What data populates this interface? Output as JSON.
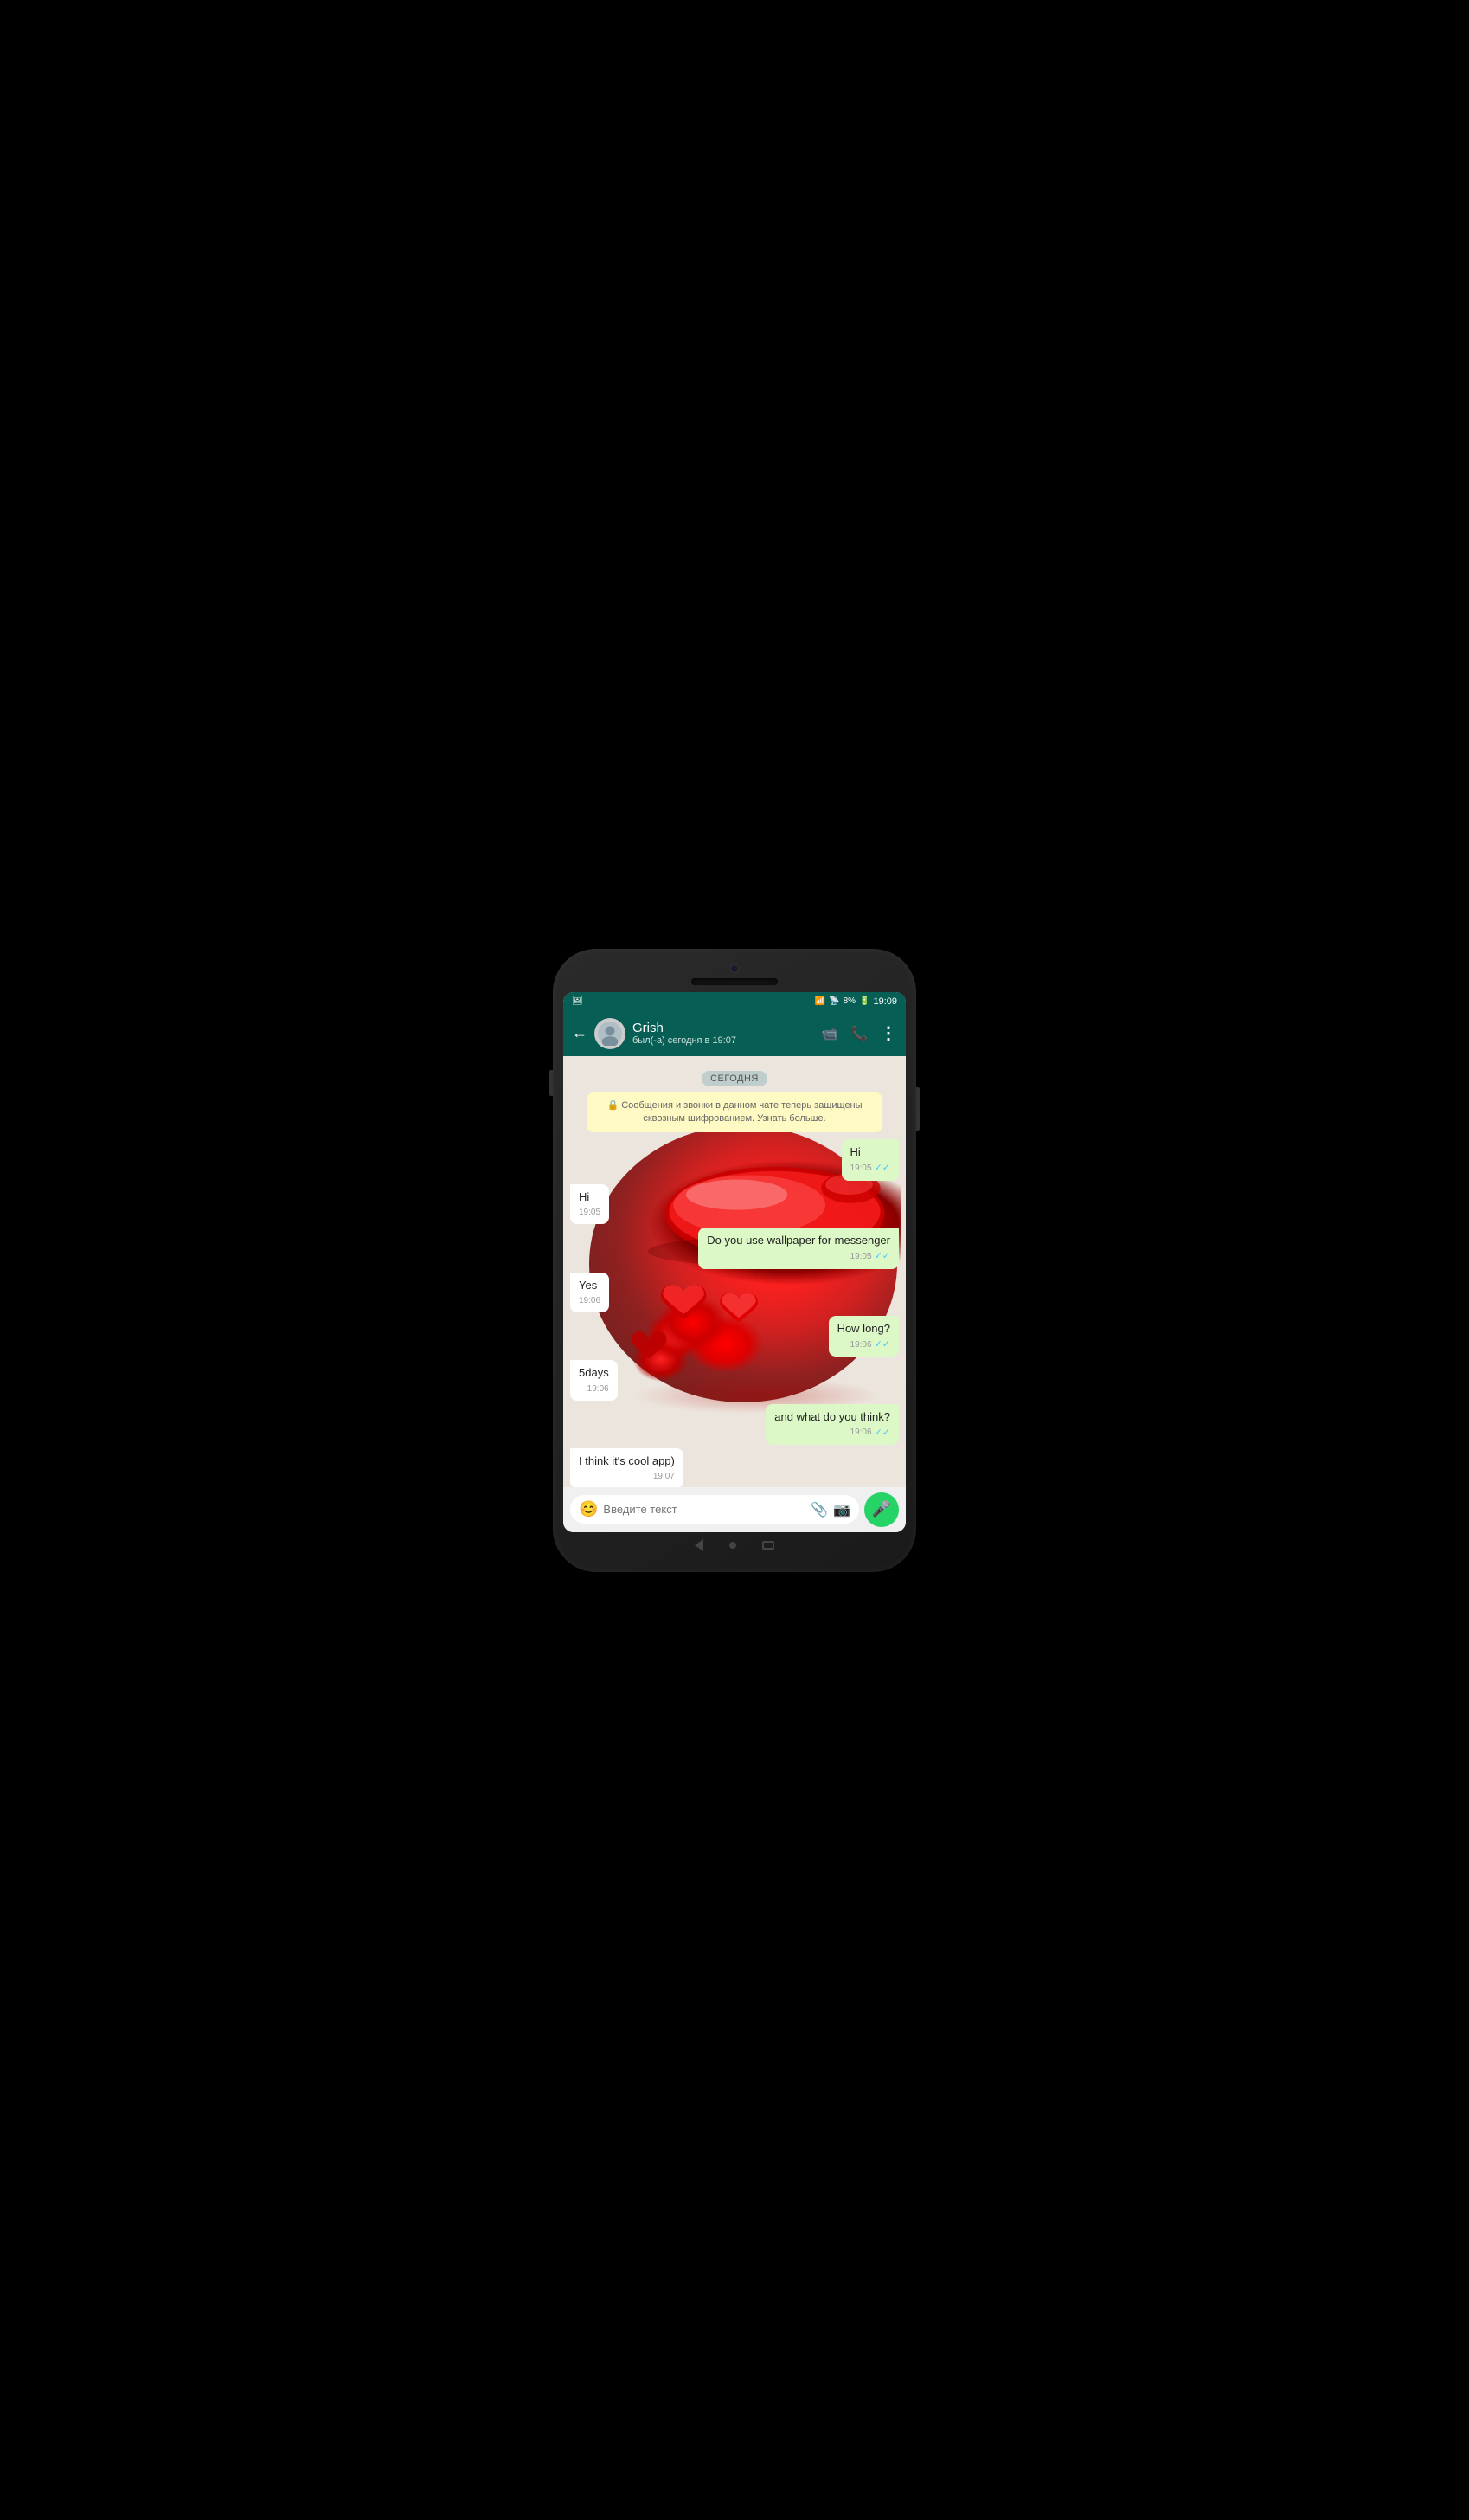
{
  "phone": {
    "status_bar": {
      "time": "19:09",
      "battery": "8%",
      "signal_icon": "📶",
      "wifi_icon": "📡"
    },
    "header": {
      "back_label": "←",
      "contact_name": "Grish",
      "contact_status": "был(-а) сегодня в 19:07",
      "video_call_icon": "video",
      "phone_call_icon": "phone",
      "more_icon": "more"
    },
    "date_badge": "СЕГОДНЯ",
    "encryption_notice": "🔒 Сообщения и звонки в данном чате теперь защищены сквозным шифрованием. Узнать больше.",
    "messages": [
      {
        "id": 1,
        "type": "sent",
        "text": "Hi",
        "time": "19:05",
        "ticks": "✓✓",
        "tick_color": "blue"
      },
      {
        "id": 2,
        "type": "received",
        "text": "Hi",
        "time": "19:05",
        "ticks": null
      },
      {
        "id": 3,
        "type": "sent",
        "text": "Do you use wallpaper for messenger",
        "time": "19:05",
        "ticks": "✓✓",
        "tick_color": "blue"
      },
      {
        "id": 4,
        "type": "received",
        "text": "Yes",
        "time": "19:06",
        "ticks": null
      },
      {
        "id": 5,
        "type": "sent",
        "text": "How long?",
        "time": "19:06",
        "ticks": "✓✓",
        "tick_color": "blue"
      },
      {
        "id": 6,
        "type": "received",
        "text": "5days",
        "time": "19:06",
        "ticks": null
      },
      {
        "id": 7,
        "type": "sent",
        "text": "and what do you think?",
        "time": "19:06",
        "ticks": "✓✓",
        "tick_color": "blue"
      },
      {
        "id": 8,
        "type": "received",
        "text": "I think it's cool app)",
        "time": "19:07",
        "ticks": null
      }
    ],
    "input_bar": {
      "placeholder": "Введите текст",
      "emoji_icon": "😊",
      "attach_icon": "📎",
      "camera_icon": "📷",
      "mic_icon": "🎤"
    }
  }
}
